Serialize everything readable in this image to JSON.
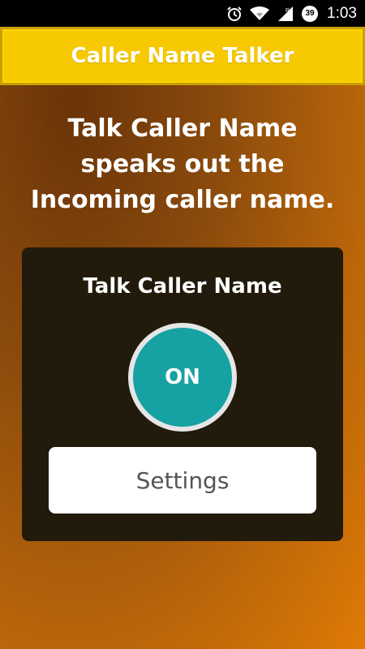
{
  "status_bar": {
    "time": "1:03",
    "battery_level": "39",
    "icons": [
      "alarm-icon",
      "wifi-icon",
      "signal-icon",
      "battery-icon"
    ]
  },
  "header": {
    "title": "Caller Name Talker",
    "background_color": "#f7c900"
  },
  "description": {
    "line1": "Talk Caller Name",
    "line2": "speaks out the",
    "line3": "Incoming caller name."
  },
  "panel": {
    "title": "Talk Caller Name",
    "toggle_label": "ON",
    "toggle_color": "#16a1a3",
    "settings_label": "Settings"
  }
}
